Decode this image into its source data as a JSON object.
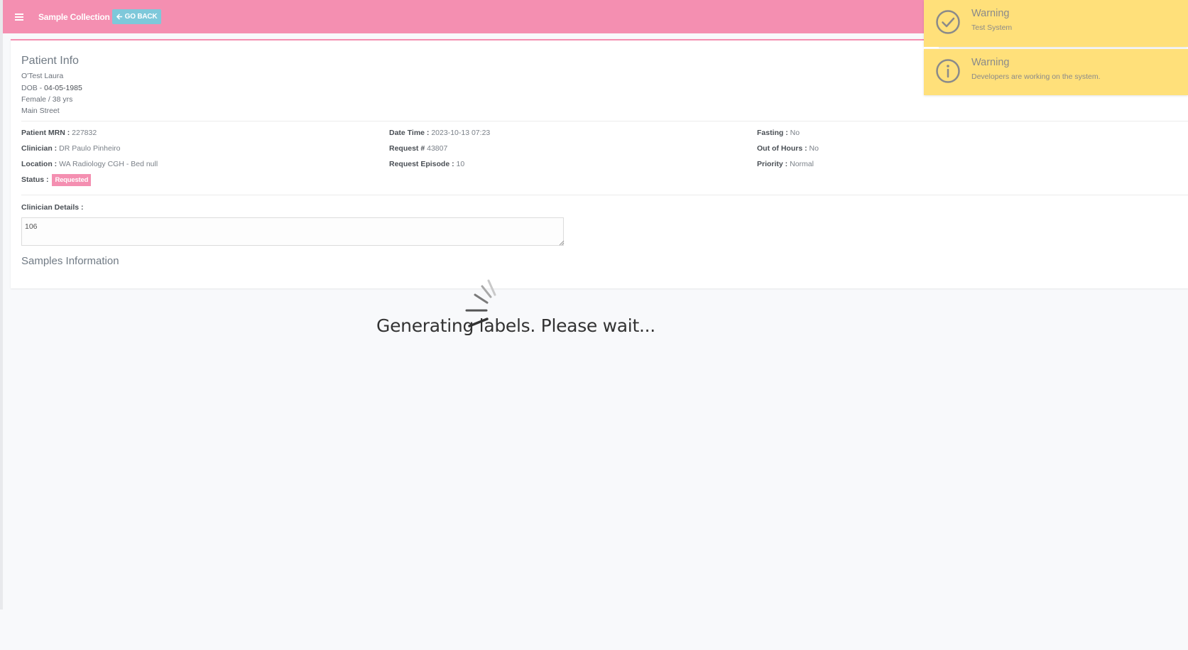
{
  "header": {
    "menu_icon": "hamburger-icon",
    "title": "Sample Collection",
    "go_back_icon": "arrow-left-icon",
    "go_back_label": "GO BACK",
    "brand_color": "#f48fb1"
  },
  "patient": {
    "heading": "Patient Info",
    "name": "O'Test Laura",
    "dob_label": "DOB - ",
    "dob_value": "04-05-1985",
    "sex_age": "Female / 38 yrs",
    "address": "Main Street"
  },
  "details": {
    "col1": [
      {
        "label": "Patient MRN :",
        "value": " 227832"
      },
      {
        "label": "Clinician :",
        "value": " DR Paulo Pinheiro"
      },
      {
        "label": "Location :",
        "value": " WA Radiology CGH - Bed null"
      }
    ],
    "status_label": "Status :",
    "status_value": "Requested",
    "col2": [
      {
        "label": "Date Time :",
        "value": " 2023-10-13 07:23"
      },
      {
        "label": "Request #",
        "value": " 43807"
      },
      {
        "label": "Request Episode :",
        "value": " 10"
      }
    ],
    "col3": [
      {
        "label": "Fasting :",
        "value": " No"
      },
      {
        "label": "Out of Hours :",
        "value": " No"
      },
      {
        "label": "Priority :",
        "value": " Normal"
      }
    ]
  },
  "clinician_details": {
    "label": "Clinician Details :",
    "value": "106"
  },
  "samples": {
    "heading": "Samples Information"
  },
  "loading": {
    "icon": "spinner-icon",
    "text": "Generating labels. Please wait..."
  },
  "toasts": [
    {
      "icon": "check-circle-icon",
      "title": "Warning",
      "message": "Test System",
      "color": "#ffe07a"
    },
    {
      "icon": "info-circle-icon",
      "title": "Warning",
      "message": "Developers are working on the system.",
      "color": "#ffe07a"
    }
  ]
}
